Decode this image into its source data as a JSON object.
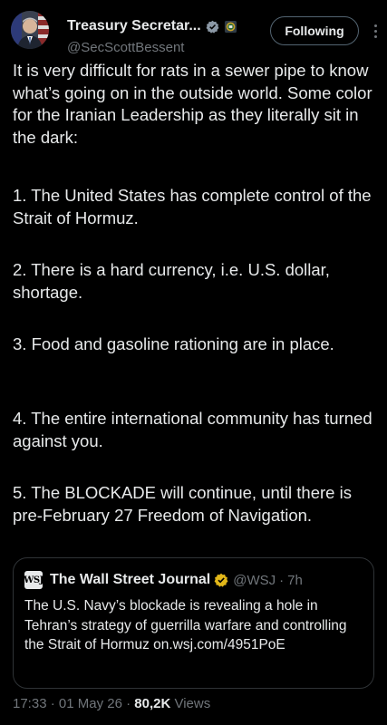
{
  "author": {
    "display_name": "Treasury Secretar...",
    "handle": "@SecScottBessent",
    "verified_badge_color": "#8b98a5",
    "follow_button_label": "Following",
    "avatar_icon": "person-avatar-icon",
    "org_badge_icon": "treasury-seal-icon"
  },
  "tweet": {
    "paragraphs": [
      "It is very difficult for rats in a sewer pipe to know what’s going on in the outside world. Some color for the Iranian Leadership as they literally sit in the dark:",
      "1. The United States has complete control of the Strait of Hormuz.",
      "2. There is a hard currency, i.e. U.S. dollar, shortage.",
      "3. Food and gasoline rationing are in place.",
      "4. The entire international community has turned against you.",
      "5. The BLOCKADE will continue, until there is pre-February 27 Freedom of Navigation."
    ]
  },
  "quote": {
    "logo_text": "WSJ",
    "name": "The Wall Street Journal",
    "handle": "@WSJ",
    "separator": "·",
    "time": "7h",
    "badge_color": "#e2b719",
    "text": "The U.S. Navy’s blockade is revealing a hole in Tehran’s strategy of guerrilla warfare and controlling the Strait of Hormuz on.wsj.com/4951PoE"
  },
  "meta": {
    "time": "17:33",
    "sep1": " · ",
    "date": "01 May 26",
    "sep2": " · ",
    "views_count": "80,2K",
    "views_label": " Views"
  },
  "colors": {
    "background": "#000000",
    "text": "#e7e9ea",
    "muted": "#71767b",
    "border": "#2f3336"
  }
}
